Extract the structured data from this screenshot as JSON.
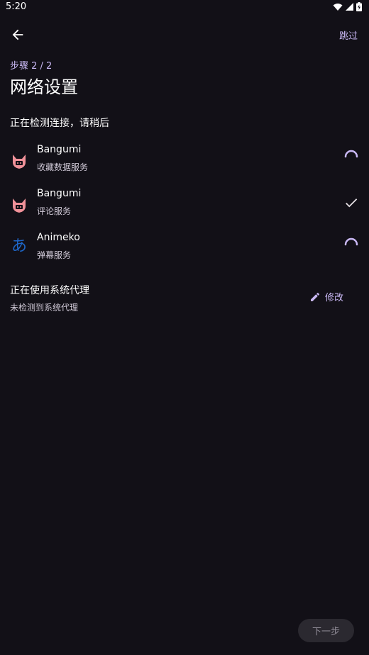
{
  "status_bar": {
    "time": "5:20"
  },
  "header": {
    "skip_label": "跳过"
  },
  "page": {
    "step": "步骤 2 / 2",
    "title": "网络设置",
    "hint": "正在检测连接，请稍后"
  },
  "services": [
    {
      "name": "Bangumi",
      "desc": "收藏数据服务",
      "icon": "bangumi-logo-icon",
      "state": "loading"
    },
    {
      "name": "Bangumi",
      "desc": "评论服务",
      "icon": "bangumi-logo-icon",
      "state": "done"
    },
    {
      "name": "Animeko",
      "desc": "弹幕服务",
      "icon": "animeko-logo-icon",
      "logo_char": "あ",
      "state": "loading"
    }
  ],
  "proxy": {
    "title": "正在使用系统代理",
    "subtitle": "未检测到系统代理",
    "edit_label": "修改"
  },
  "footer": {
    "next_label": "下一步"
  },
  "colors": {
    "accent": "#C9B8F4",
    "background": "#121017",
    "bangumi_pink": "#F09199",
    "animeko_blue": "#1E66C8"
  }
}
